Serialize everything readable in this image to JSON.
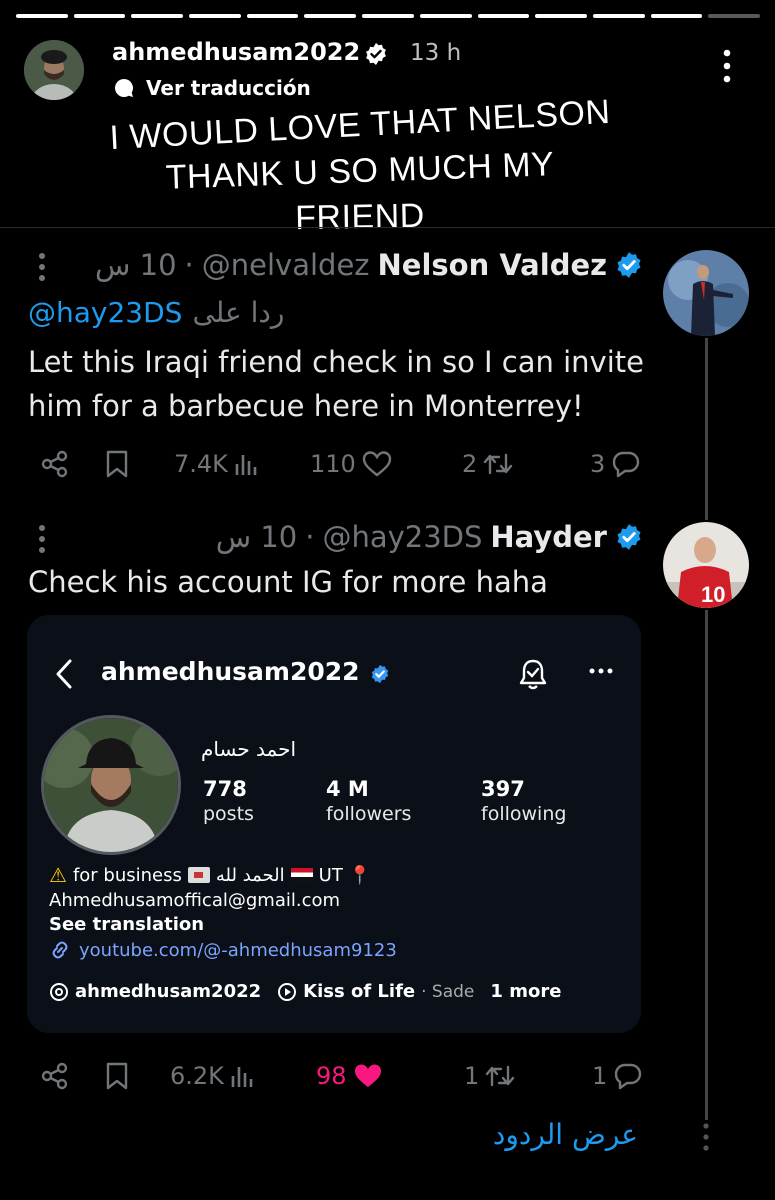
{
  "story": {
    "progress_segments": 13,
    "progress_done": 12,
    "username": "ahmedhusam2022",
    "time": "13 h",
    "translate_label": "Ver traducción",
    "caption_lines": [
      "I WOULD LOVE THAT NELSON",
      "THANK U SO MUCH MY",
      "FRIEND"
    ]
  },
  "tweet1": {
    "name": "Nelson Valdez",
    "handle": "@nelvaldez",
    "time": "10 س",
    "reply_prefix": "ردا على",
    "reply_mention": "@hay23DS",
    "text_lines": [
      "Let this Iraqi friend check in so I can invite",
      "him for a barbecue here in Monterrey!"
    ],
    "views": "7.4K",
    "likes": "110",
    "reposts": "2",
    "replies": "3"
  },
  "tweet2": {
    "name": "Hayder",
    "handle": "@hay23DS",
    "time": "10 س",
    "text": "Check his account IG for more haha",
    "views": "6.2K",
    "likes": "98",
    "reposts": "1",
    "replies": "1"
  },
  "ig_card": {
    "username": "ahmedhusam2022",
    "display_name": "احمد حسام",
    "posts_count": "778",
    "posts_label": "posts",
    "followers_count": "4 M",
    "followers_label": "followers",
    "following_count": "397",
    "following_label": "following",
    "bio_line1_a": "for business",
    "bio_line1_b": "الحمد لله",
    "bio_line1_c": "UT",
    "email": "Ahmedhusamoffical@gmail.com",
    "see_translation": "See translation",
    "link": "youtube.com/@-ahmedhusam9123",
    "threads_handle": "ahmedhusam2022",
    "music_title": "Kiss of Life",
    "music_artist": "· Sade",
    "more_label": "1 more"
  },
  "show_replies": "عرض الردود",
  "colors": {
    "accent_blue": "#1d9bf0",
    "muted_gray": "#71767b",
    "like_pink": "#f91880",
    "verified_blue": "#1d9bf0"
  }
}
